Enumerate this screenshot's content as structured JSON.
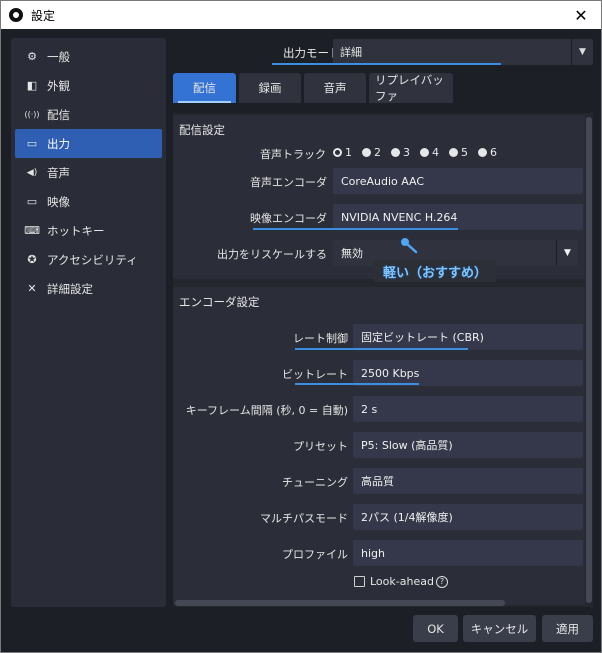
{
  "window": {
    "title": "設定",
    "close_label": "✕"
  },
  "sidebar": {
    "items": [
      {
        "icon": "gear-icon",
        "glyph": "⚙",
        "label": "一般"
      },
      {
        "icon": "appearance-icon",
        "glyph": "◧",
        "label": "外観"
      },
      {
        "icon": "stream-icon",
        "glyph": "((·))",
        "label": "配信"
      },
      {
        "icon": "output-icon",
        "glyph": "▭",
        "label": "出力",
        "active": true
      },
      {
        "icon": "speaker-icon",
        "glyph": "◀)",
        "label": "音声"
      },
      {
        "icon": "monitor-icon",
        "glyph": "▭",
        "label": "映像"
      },
      {
        "icon": "keyboard-icon",
        "glyph": "⌨",
        "label": "ホットキー"
      },
      {
        "icon": "accessibility-icon",
        "glyph": "✪",
        "label": "アクセシビリティ"
      },
      {
        "icon": "tools-icon",
        "glyph": "✕",
        "label": "詳細設定"
      }
    ]
  },
  "output_mode": {
    "label": "出力モード",
    "value": "詳細"
  },
  "tabs": [
    "配信",
    "録画",
    "音声",
    "リプレイバッファ"
  ],
  "stream_settings": {
    "title": "配信設定",
    "audio_track": {
      "label": "音声トラック",
      "options": [
        "1",
        "2",
        "3",
        "4",
        "5",
        "6"
      ],
      "selected": "1"
    },
    "audio_encoder": {
      "label": "音声エンコーダ",
      "value": "CoreAudio AAC"
    },
    "video_encoder": {
      "label": "映像エンコーダ",
      "value": "NVIDIA NVENC H.264"
    },
    "rescale": {
      "label": "出力をリスケールする",
      "value": "無効"
    }
  },
  "tooltip": {
    "text": "軽い（おすすめ）"
  },
  "encoder_settings": {
    "title": "エンコーダ設定",
    "rate_control": {
      "label": "レート制御",
      "value": "固定ビットレート (CBR)"
    },
    "bitrate": {
      "label": "ビットレート",
      "value": "2500 Kbps"
    },
    "keyframe": {
      "label": "キーフレーム間隔 (秒, 0 = 自動)",
      "value": "2 s"
    },
    "preset": {
      "label": "プリセット",
      "value": "P5: Slow (高品質)"
    },
    "tuning": {
      "label": "チューニング",
      "value": "高品質"
    },
    "multipass": {
      "label": "マルチパスモード",
      "value": "2パス (1/4解像度)"
    },
    "profile": {
      "label": "プロファイル",
      "value": "high"
    },
    "lookahead": {
      "label": "Look-ahead",
      "help": "?"
    }
  },
  "footer": {
    "ok": "OK",
    "cancel": "キャンセル",
    "apply": "適用"
  },
  "colors": {
    "accent": "#3473d4",
    "underline": "#3a8fe0",
    "tooltip_text": "#7ec6ff"
  }
}
